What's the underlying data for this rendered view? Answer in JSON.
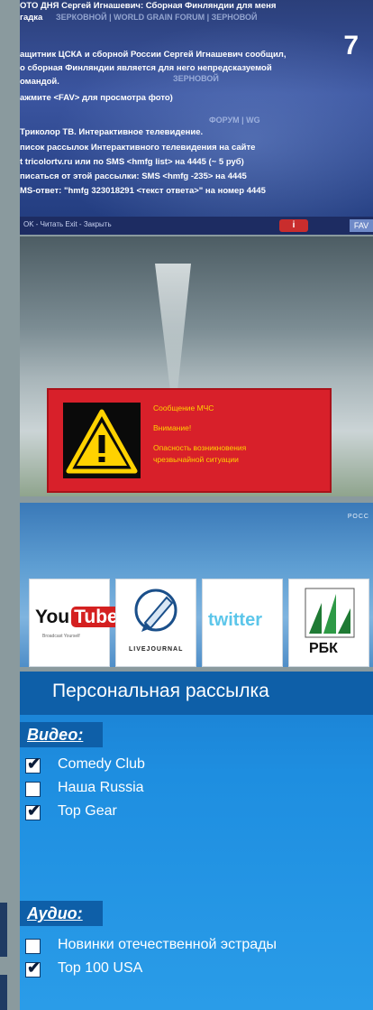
{
  "page_number": "7",
  "panel_news": {
    "lines": [
      "ОТО ДНЯ Сергей Игнашевич: Сборная Финляндии для меня",
      "гадка",
      "ащитник ЦСКА и сборной России Сергей Игнашевич сообщил,",
      "о сборная Финляндии является для него непредсказуемой",
      "омандой.",
      "ажмите <FAV> для просмотра фото)",
      "Триколор ТВ. Интерактивное телевидение.",
      "писок рассылок Интерактивного телевидения на сайте",
      "t tricolortv.ru или по SMS <hmfg list> на 4445 (~ 5 руб)",
      "писаться от этой рассылки: SMS <hmfg -235> на 4445",
      "MS-ответ: \"hmfg 323018291 <текст ответа>\" на номер 4445"
    ],
    "brands": [
      "ЗЕРКОВНОЙ  |  WORLD GRAIN FORUM  |  ЗЕРНОВОЙ",
      "ЗЕРНОВОЙ",
      "ФОРУМ  |  WG"
    ],
    "bottom_hint": "OK - Читать   Exit - Закрыть",
    "info_label": "i",
    "fav_label": "FAV"
  },
  "panel_alert": {
    "title": "Сообщение МЧС",
    "attention": "Внимание!",
    "message_line1": "Опасность возникновения",
    "message_line2": "чрезвычайной ситуации",
    "warning_icon": "warning-triangle-icon"
  },
  "panel_apps": {
    "corner_text": "РОСС",
    "apps": [
      {
        "name": "YouTube",
        "part1": "You",
        "part2": "Tube",
        "caption": "Broadcast Yourself",
        "icon": "youtube-icon"
      },
      {
        "name": "LiveJournal",
        "caption": "LIVEJOURNAL",
        "icon": "livejournal-pencil-icon"
      },
      {
        "name": "twitter",
        "caption": "twitter",
        "icon": "twitter-icon"
      },
      {
        "name": "РБК",
        "caption": "РБК",
        "icon": "rbk-icon"
      }
    ]
  },
  "panel_subscription": {
    "title": "Персональная рассылка",
    "sections": [
      {
        "label": "Видео:",
        "items": [
          {
            "label": "Comedy Club",
            "checked": true
          },
          {
            "label": "Наша Russia",
            "checked": false
          },
          {
            "label": "Top Gear",
            "checked": true
          }
        ]
      },
      {
        "label": "Аудио:",
        "items": [
          {
            "label": "Новинки отечественной эстрады",
            "checked": false
          },
          {
            "label": "Top 100 USA",
            "checked": true
          }
        ]
      }
    ],
    "check_glyph": "✔"
  },
  "colors": {
    "news_bg": "#2b3f7a",
    "alert_red": "#d8202a",
    "alert_text": "#ffd200",
    "subscription_blue": "#1e8ee0",
    "title_bar": "#0e5fa8"
  }
}
